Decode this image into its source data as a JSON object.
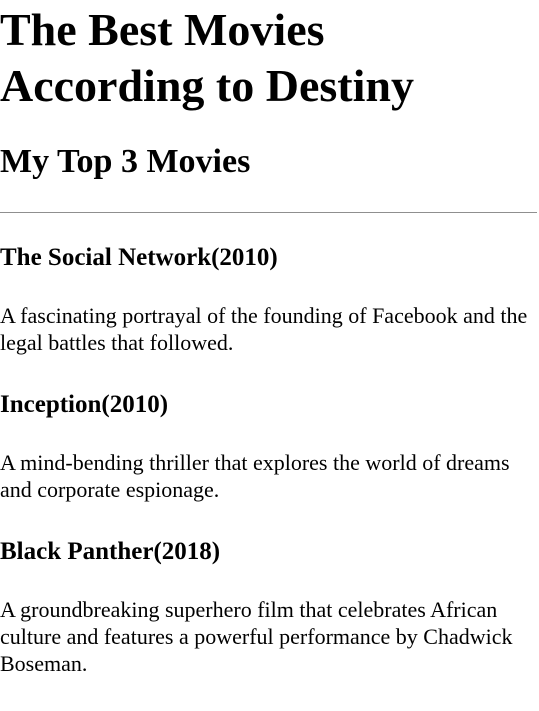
{
  "page": {
    "title": "The Best Movies According to Destiny",
    "section_title": "My Top 3 Movies"
  },
  "movies": [
    {
      "heading": "The Social Network(2010)",
      "description": "A fascinating portrayal of the founding of Facebook and the legal battles that followed."
    },
    {
      "heading": "Inception(2010)",
      "description": "A mind-bending thriller that explores the world of dreams and corporate espionage."
    },
    {
      "heading": "Black Panther(2018)",
      "description": "A groundbreaking superhero film that celebrates African culture and features a powerful performance by Chadwick Boseman."
    }
  ]
}
